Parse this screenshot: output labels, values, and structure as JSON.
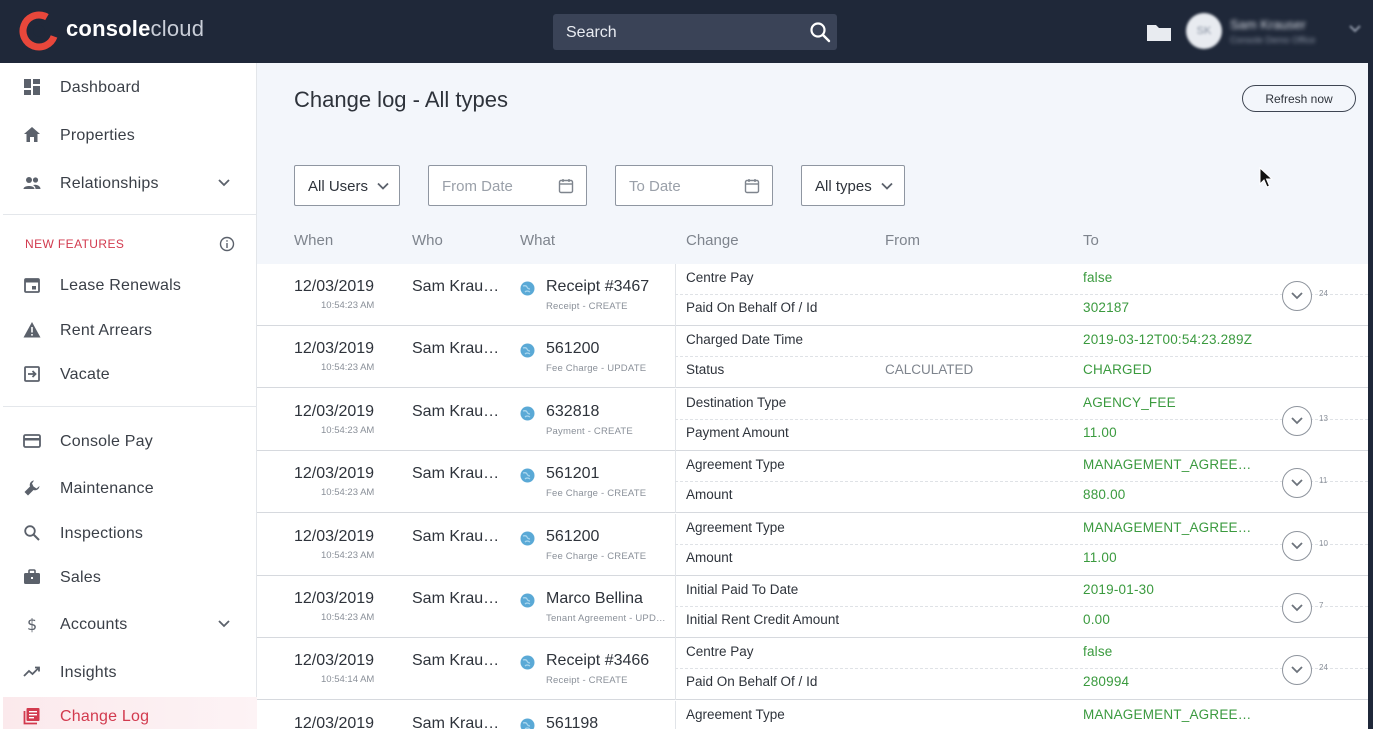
{
  "brand": {
    "name_bold": "console",
    "name_light": "cloud",
    "colors": {
      "red": "#e8473b",
      "navy": "#1f2839",
      "green": "#3a9a3e"
    }
  },
  "header": {
    "search_placeholder": "Search",
    "user_name": "Sam Krauser",
    "user_subtitle": "Console Demo Office",
    "avatar_initials": "SK"
  },
  "sidebar": {
    "items": [
      {
        "label": "Dashboard",
        "icon": "dashboard-icon"
      },
      {
        "label": "Properties",
        "icon": "home-icon"
      },
      {
        "label": "Relationships",
        "icon": "people-icon"
      }
    ],
    "new_features_title": "NEW FEATURES",
    "new_features": [
      {
        "label": "Lease Renewals",
        "icon": "calendar-icon"
      },
      {
        "label": "Rent Arrears",
        "icon": "warning-icon"
      },
      {
        "label": "Vacate",
        "icon": "exit-icon"
      }
    ],
    "tools": [
      {
        "label": "Console Pay",
        "icon": "credit-card-icon"
      },
      {
        "label": "Maintenance",
        "icon": "wrench-icon"
      },
      {
        "label": "Inspections",
        "icon": "magnifier-icon"
      },
      {
        "label": "Sales",
        "icon": "briefcase-icon"
      },
      {
        "label": "Accounts",
        "icon": "dollar-icon"
      },
      {
        "label": "Insights",
        "icon": "trending-icon"
      },
      {
        "label": "Change Log",
        "icon": "log-icon"
      }
    ]
  },
  "page": {
    "title": "Change log - All types",
    "refresh_label": "Refresh now",
    "filters": {
      "users": "All Users",
      "from_date_placeholder": "From Date",
      "to_date_placeholder": "To Date",
      "types": "All types"
    },
    "columns": {
      "when": "When",
      "who": "Who",
      "what": "What",
      "change": "Change",
      "from": "From",
      "to": "To"
    }
  },
  "log": {
    "rows": [
      {
        "date": "12/03/2019",
        "time": "10:54:23 AM",
        "who": "Sam Krauser",
        "what": "Receipt #3467",
        "what_sub": "Receipt - CREATE",
        "field1": "Centre Pay",
        "from1": "",
        "to1": "false",
        "field2": "Paid On Behalf Of / Id",
        "from2": "",
        "to2": "302187",
        "count": "24"
      },
      {
        "date": "12/03/2019",
        "time": "10:54:23 AM",
        "who": "Sam Krauser",
        "what": "561200",
        "what_sub": "Fee Charge - UPDATE",
        "field1": "Charged Date Time",
        "from1": "",
        "to1": "2019-03-12T00:54:23.289Z",
        "field2": "Status",
        "from2": "CALCULATED",
        "to2": "CHARGED",
        "count": ""
      },
      {
        "date": "12/03/2019",
        "time": "10:54:23 AM",
        "who": "Sam Krauser",
        "what": "632818",
        "what_sub": "Payment - CREATE",
        "field1": "Destination Type",
        "from1": "",
        "to1": "AGENCY_FEE",
        "field2": "Payment Amount",
        "from2": "",
        "to2": "11.00",
        "count": "13"
      },
      {
        "date": "12/03/2019",
        "time": "10:54:23 AM",
        "who": "Sam Krauser",
        "what": "561201",
        "what_sub": "Fee Charge - CREATE",
        "field1": "Agreement Type",
        "from1": "",
        "to1": "MANAGEMENT_AGREEMENT",
        "field2": "Amount",
        "from2": "",
        "to2": "880.00",
        "count": "11"
      },
      {
        "date": "12/03/2019",
        "time": "10:54:23 AM",
        "who": "Sam Krauser",
        "what": "561200",
        "what_sub": "Fee Charge - CREATE",
        "field1": "Agreement Type",
        "from1": "",
        "to1": "MANAGEMENT_AGREEMENT",
        "field2": "Amount",
        "from2": "",
        "to2": "11.00",
        "count": "10"
      },
      {
        "date": "12/03/2019",
        "time": "10:54:23 AM",
        "who": "Sam Krauser",
        "what": "Marco Bellina",
        "what_sub": "Tenant Agreement - UPDATE",
        "field1": "Initial Paid To Date",
        "from1": "",
        "to1": "2019-01-30",
        "field2": "Initial Rent Credit Amount",
        "from2": "",
        "to2": "0.00",
        "count": "7"
      },
      {
        "date": "12/03/2019",
        "time": "10:54:14 AM",
        "who": "Sam Krauser",
        "what": "Receipt #3466",
        "what_sub": "Receipt - CREATE",
        "field1": "Centre Pay",
        "from1": "",
        "to1": "false",
        "field2": "Paid On Behalf Of / Id",
        "from2": "",
        "to2": "280994",
        "count": "24"
      },
      {
        "date": "12/03/2019",
        "time": "",
        "who": "Sam Krauser",
        "what": "561198",
        "what_sub": "",
        "field1": "Agreement Type",
        "from1": "",
        "to1": "MANAGEMENT_AGREEMENT",
        "field2": "",
        "from2": "",
        "to2": "",
        "count": ""
      }
    ]
  }
}
